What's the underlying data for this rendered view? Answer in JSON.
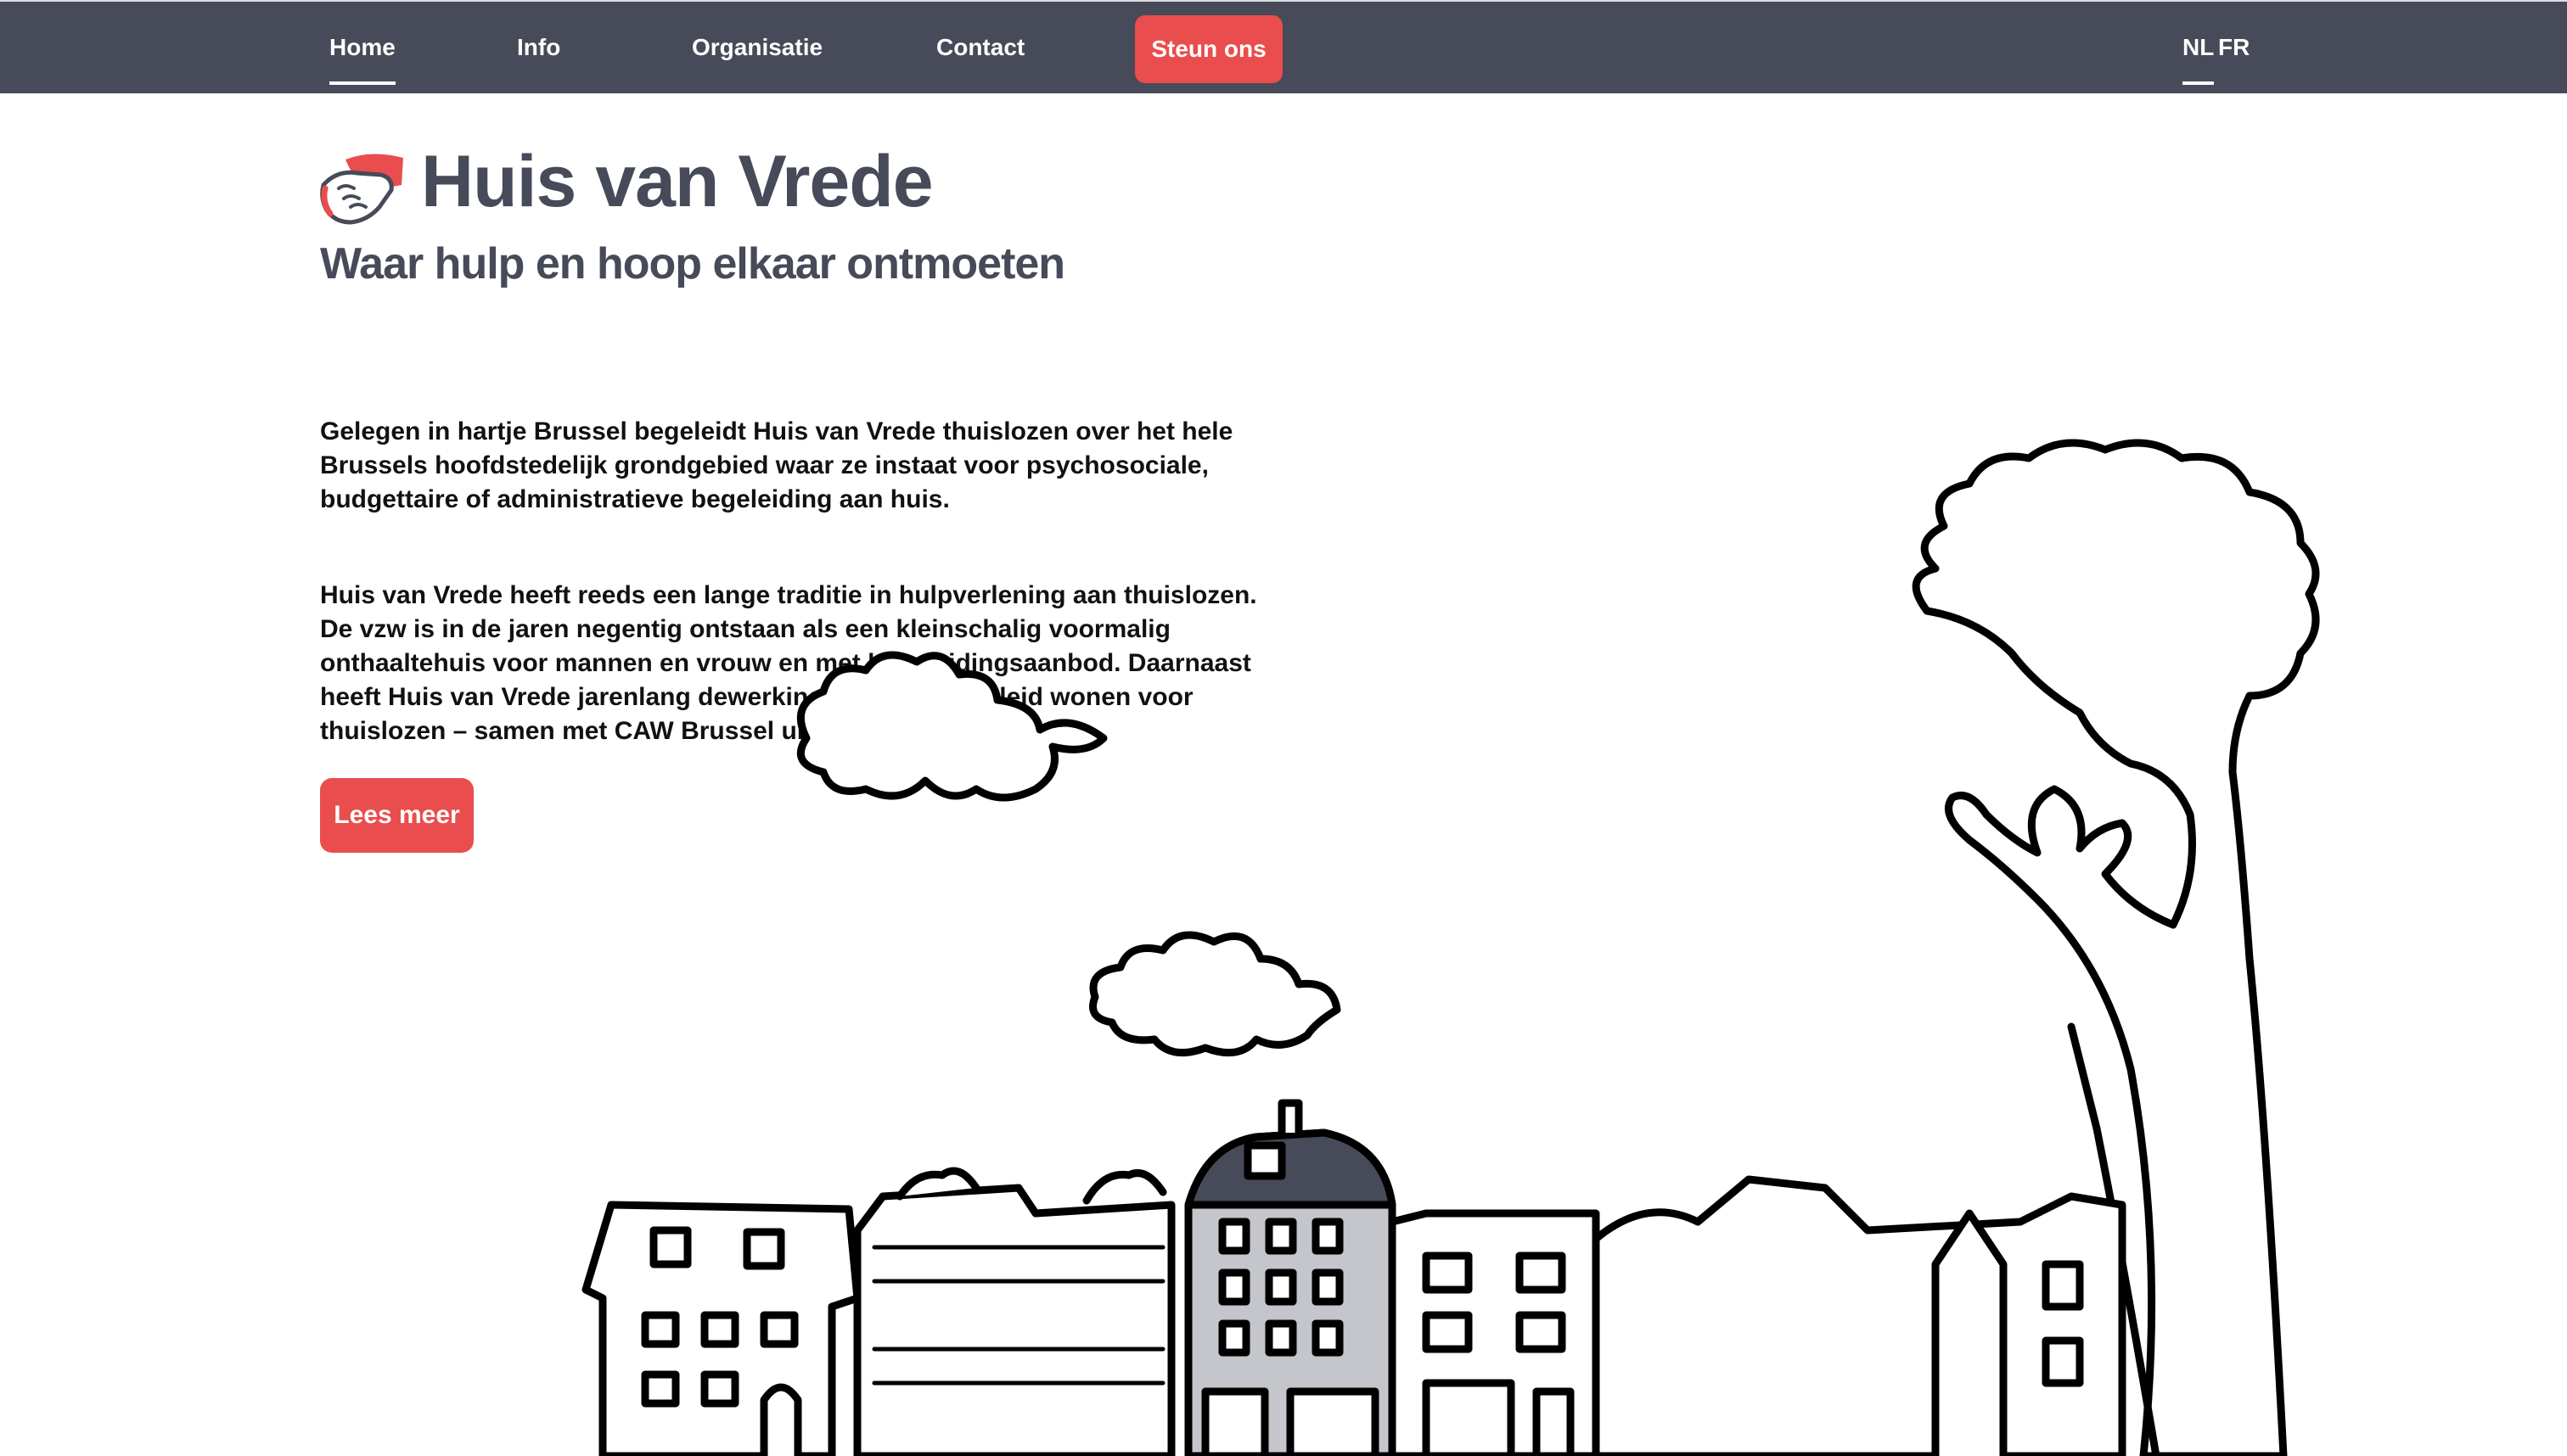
{
  "nav": {
    "items": [
      {
        "label": "Home",
        "active": true
      },
      {
        "label": "Info"
      },
      {
        "label": "Organisatie"
      },
      {
        "label": "Contact"
      }
    ],
    "donate_label": "Steun ons",
    "languages": [
      {
        "label": "NL",
        "active": true
      },
      {
        "label": "FR"
      }
    ]
  },
  "hero": {
    "title": "Huis van Vrede",
    "tagline": "Waar hulp en hoop elkaar ontmoeten",
    "paragraphs": [
      "Gelegen in hartje Brussel begeleidt Huis van Vrede thuislozen over het hele Brussels hoofdstedelijk grondgebied waar ze instaat voor psychosociale, budgettaire of administratieve begeleiding aan huis.",
      "Huis van Vrede heeft reeds een lange traditie in hulpverlening aan thuislozen. De vzw is in de jaren negentig ontstaan als een kleinschalig voormalig onthaaltehuis voor mannen en vrouw en met begeleidingsaanbod. Daarnaast heeft Huis van Vrede jarenlang dewerking Puerto – begeleid wonen voor thuislozen – samen met CAW Brussel uitgebaat."
    ],
    "read_more_label": "Lees meer"
  },
  "colors": {
    "navbar": "#474a58",
    "accent": "#ea4d4d",
    "title": "#474a58"
  },
  "icons": {
    "logo": "handshake-icon"
  }
}
